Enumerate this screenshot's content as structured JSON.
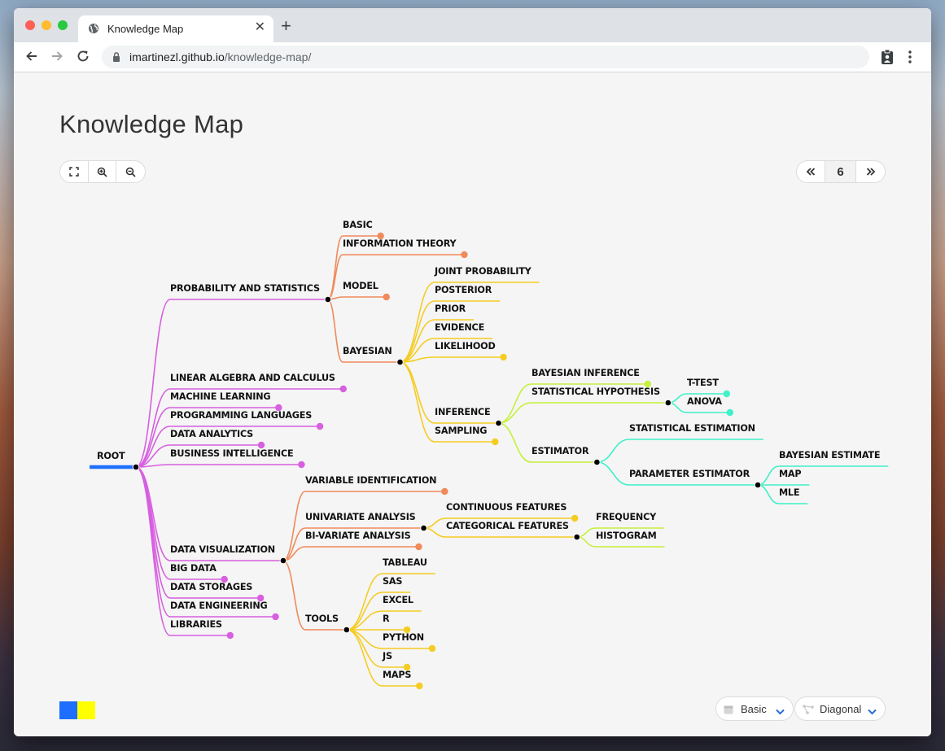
{
  "browser": {
    "tab_title": "Knowledge Map",
    "url_host": "imartinezl.github.io",
    "url_path": "/knowledge-map/"
  },
  "page": {
    "title": "Knowledge Map",
    "page_number": "6",
    "layout_select": "Basic",
    "link_select": "Diagonal"
  },
  "colors": {
    "root": "#1e6fff",
    "level1": "#d75fe0",
    "level2": "#f08a5b",
    "level3": "#f5cc23",
    "level4": "#c5f03c",
    "level5": "#3ff0c8",
    "swatch_a": "#1e6fff",
    "swatch_b": "#ffff00"
  },
  "tree": {
    "label": "ROOT",
    "children": [
      {
        "label": "PROBABILITY AND STATISTICS",
        "children": [
          {
            "label": "BASIC"
          },
          {
            "label": "INFORMATION THEORY"
          },
          {
            "label": "MODEL"
          },
          {
            "label": "BAYESIAN",
            "children": [
              {
                "label": "JOINT PROBABILITY"
              },
              {
                "label": "POSTERIOR"
              },
              {
                "label": "PRIOR"
              },
              {
                "label": "EVIDENCE"
              },
              {
                "label": "LIKELIHOOD"
              },
              {
                "label": "INFERENCE",
                "children": [
                  {
                    "label": "BAYESIAN INFERENCE"
                  },
                  {
                    "label": "STATISTICAL HYPOTHESIS",
                    "children": [
                      {
                        "label": "T-TEST"
                      },
                      {
                        "label": "ANOVA"
                      }
                    ]
                  },
                  {
                    "label": "ESTIMATOR",
                    "children": [
                      {
                        "label": "STATISTICAL ESTIMATION"
                      },
                      {
                        "label": "PARAMETER ESTIMATOR",
                        "children": [
                          {
                            "label": "BAYESIAN ESTIMATE"
                          },
                          {
                            "label": "MAP"
                          },
                          {
                            "label": "MLE"
                          }
                        ]
                      }
                    ]
                  }
                ]
              },
              {
                "label": "SAMPLING"
              }
            ]
          }
        ]
      },
      {
        "label": "LINEAR ALGEBRA AND CALCULUS"
      },
      {
        "label": "MACHINE LEARNING"
      },
      {
        "label": "PROGRAMMING LANGUAGES"
      },
      {
        "label": "DATA ANALYTICS"
      },
      {
        "label": "BUSINESS INTELLIGENCE"
      },
      {
        "label": "DATA VISUALIZATION",
        "children": [
          {
            "label": "VARIABLE IDENTIFICATION"
          },
          {
            "label": "UNIVARIATE ANALYSIS",
            "children": [
              {
                "label": "CONTINUOUS FEATURES"
              },
              {
                "label": "CATEGORICAL FEATURES",
                "children": [
                  {
                    "label": "FREQUENCY"
                  },
                  {
                    "label": "HISTOGRAM"
                  }
                ]
              }
            ]
          },
          {
            "label": "BI-VARIATE ANALYSIS"
          },
          {
            "label": "TOOLS",
            "children": [
              {
                "label": "TABLEAU"
              },
              {
                "label": "SAS"
              },
              {
                "label": "EXCEL"
              },
              {
                "label": "R"
              },
              {
                "label": "PYTHON"
              },
              {
                "label": "JS"
              },
              {
                "label": "MAPS"
              }
            ]
          }
        ]
      },
      {
        "label": "BIG DATA"
      },
      {
        "label": "DATA STORAGES"
      },
      {
        "label": "DATA ENGINEERING"
      },
      {
        "label": "LIBRARIES"
      }
    ]
  }
}
